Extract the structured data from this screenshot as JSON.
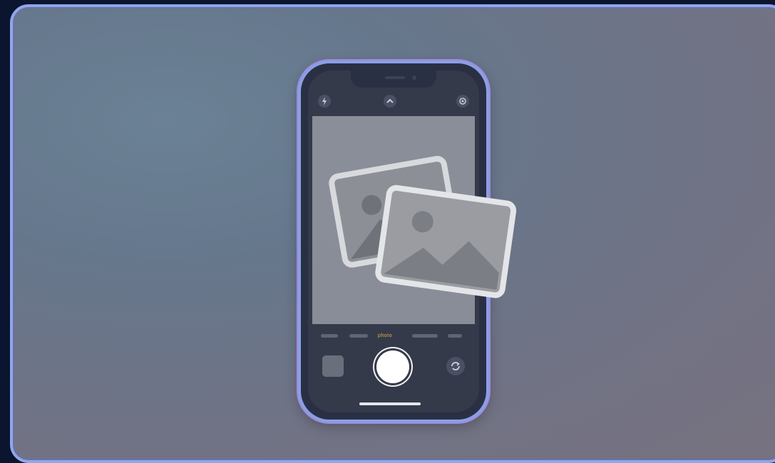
{
  "camera": {
    "top_bar_icons": [
      "flash-icon",
      "chevron-up-icon",
      "live-photo-icon"
    ],
    "mode_selected_label": "photo",
    "bottom_icons": [
      "last-photo-thumbnail",
      "shutter-button",
      "flip-camera-icon"
    ]
  },
  "overlay": {
    "icon": "photos-gallery-icon"
  },
  "colors": {
    "frame_border": "#8fa7e6",
    "phone_border": "#8a9fe6",
    "phone_glow": "#a08adb",
    "mode_highlight": "#d9b94a",
    "background_dark": "#0b1530"
  }
}
